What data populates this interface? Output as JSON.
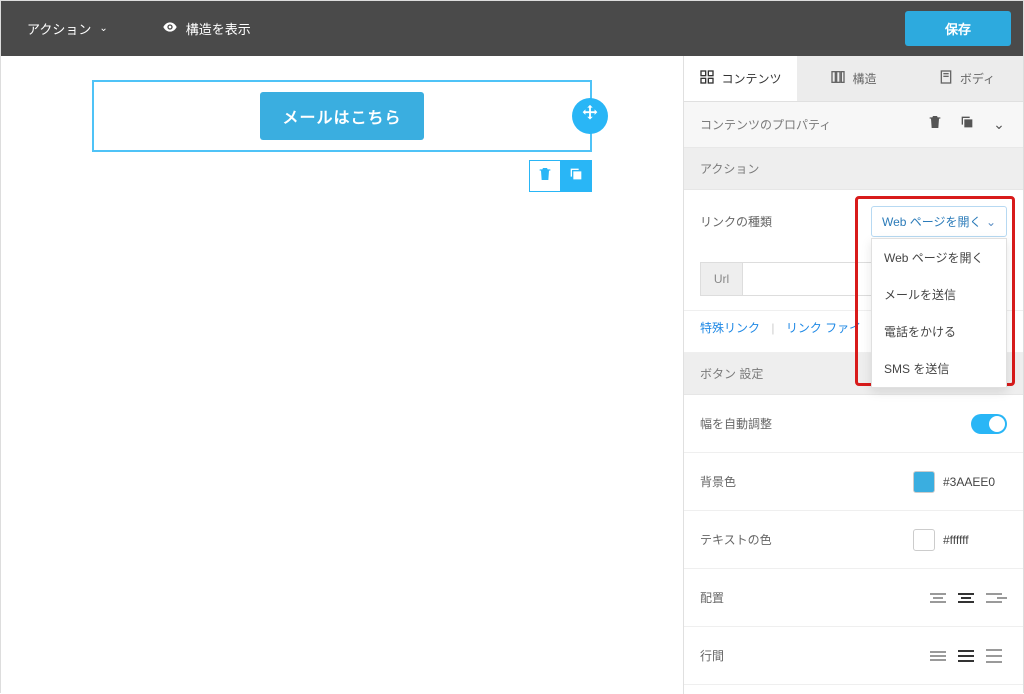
{
  "topbar": {
    "action_label": "アクション",
    "show_structure_label": "構造を表示",
    "save_label": "保存"
  },
  "sideTabs": {
    "contents": "コンテンツ",
    "structure": "構造",
    "body": "ボディ"
  },
  "propHeader": {
    "title": "コンテンツのプロパティ"
  },
  "sections": {
    "action": "アクション",
    "buttonSettings": "ボタン 設定"
  },
  "canvas": {
    "button_text": "メールはこちら"
  },
  "form": {
    "linkTypeLabel": "リンクの種類",
    "linkTypeSelected": "Web ページを開く",
    "linkTypeOptions": [
      "Web ページを開く",
      "メールを送信",
      "電話をかける",
      "SMS を送信"
    ],
    "urlLabel": "Url",
    "urlValue": "",
    "specialLinks": "特殊リンク",
    "linkFile": "リンク ファイ",
    "autoWidthLabel": "幅を自動調整",
    "bgColorLabel": "背景色",
    "bgColorValue": "#3AAEE0",
    "textColorLabel": "テキストの色",
    "textColorValue": "#ffffff",
    "alignLabel": "配置",
    "lineHeightLabel": "行間"
  }
}
